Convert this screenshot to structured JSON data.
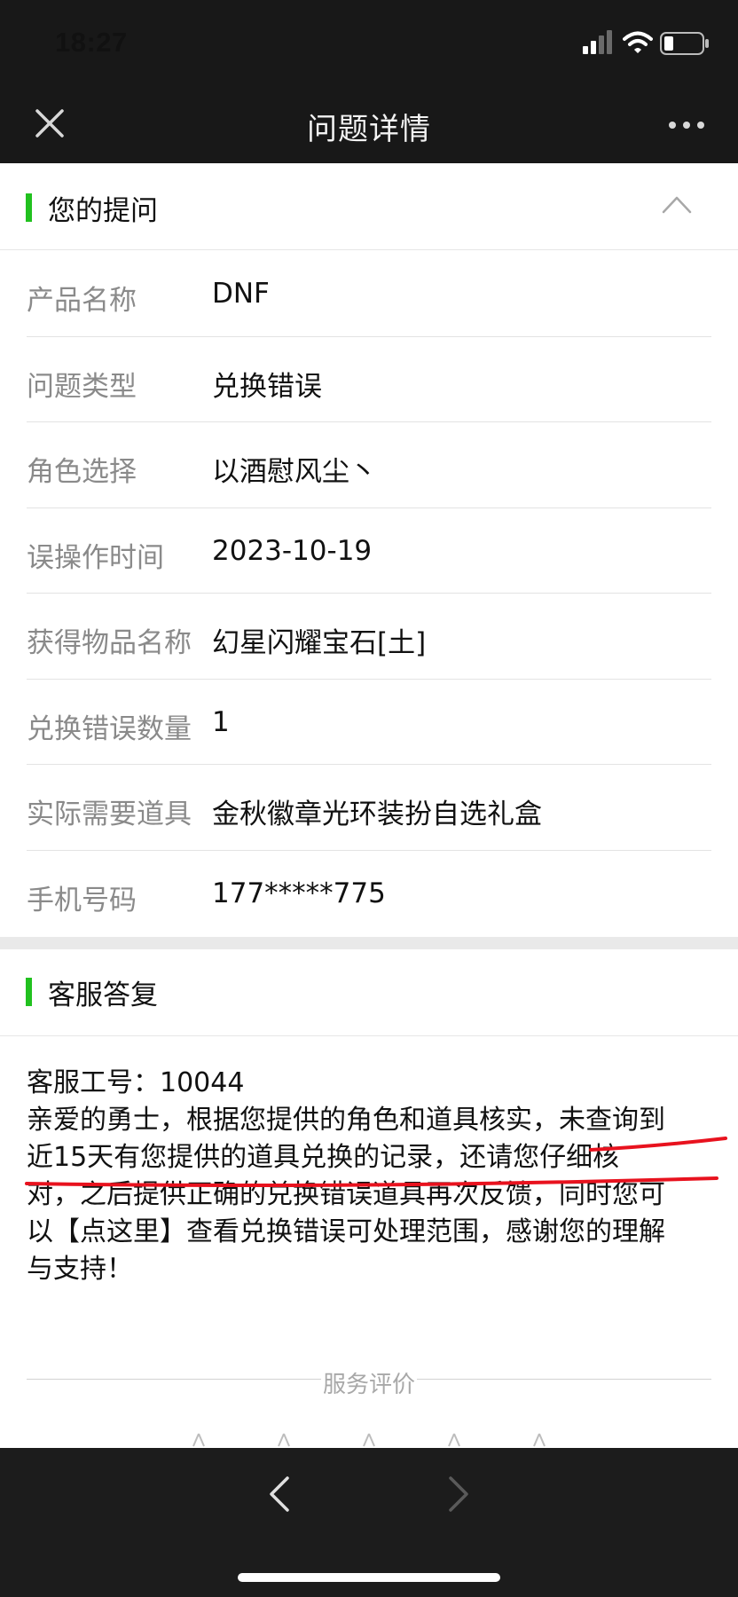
{
  "status_bar": {
    "time": "18:27"
  },
  "nav": {
    "title": "问题详情"
  },
  "question_section": {
    "title": "您的提问"
  },
  "fields": [
    {
      "label": "产品名称",
      "value": "DNF"
    },
    {
      "label": "问题类型",
      "value": "兑换错误"
    },
    {
      "label": "角色选择",
      "value": "以酒慰风尘丶"
    },
    {
      "label": "误操作时间",
      "value": "2023-10-19"
    },
    {
      "label": "获得物品名称",
      "value": "幻星闪耀宝石[土]"
    },
    {
      "label": "兑换错误数量",
      "value": "1"
    },
    {
      "label": "实际需要道具",
      "value": "金秋徽章光环装扮自选礼盒"
    },
    {
      "label": "手机号码",
      "value": "177*****775"
    }
  ],
  "reply_section": {
    "title": "客服答复",
    "staff_id": "客服工号：10044",
    "lines": [
      "亲爱的勇士，根据您提供的角色和道具核实，未查询到",
      "近15天有您提供的道具兑换的记录，还请您仔细核",
      "对，之后提供正确的兑换错误道具再次反馈，同时您可",
      "以【点这里】查看兑换错误可处理范围，感谢您的理解",
      "与支持！"
    ]
  },
  "rating": {
    "title": "服务评价",
    "star_count": 5
  },
  "colors": {
    "accent": "#21c11f",
    "underline_annotation": "#e8121e",
    "header_bg": "#181818"
  }
}
